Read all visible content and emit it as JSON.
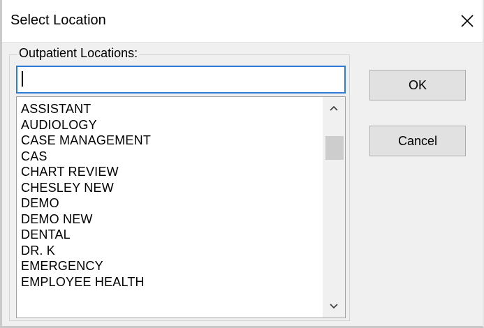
{
  "window": {
    "title": "Select Location",
    "close_icon": "close-icon"
  },
  "group": {
    "label": "Outpatient Locations:"
  },
  "search": {
    "value": "",
    "placeholder": ""
  },
  "locations": [
    "ASSISTANT",
    "AUDIOLOGY",
    "CASE MANAGEMENT",
    "CAS",
    "CHART REVIEW",
    "CHESLEY NEW",
    "DEMO",
    "DEMO NEW",
    "DENTAL",
    "DR. K",
    "EMERGENCY",
    "EMPLOYEE HEALTH"
  ],
  "buttons": {
    "ok_label": "OK",
    "cancel_label": "Cancel"
  },
  "scrollbar": {
    "up_icon": "chevron-up-icon",
    "down_icon": "chevron-down-icon"
  },
  "colors": {
    "input_focus_border": "#2d7bd6",
    "dialog_bg": "#f0f0f0"
  }
}
